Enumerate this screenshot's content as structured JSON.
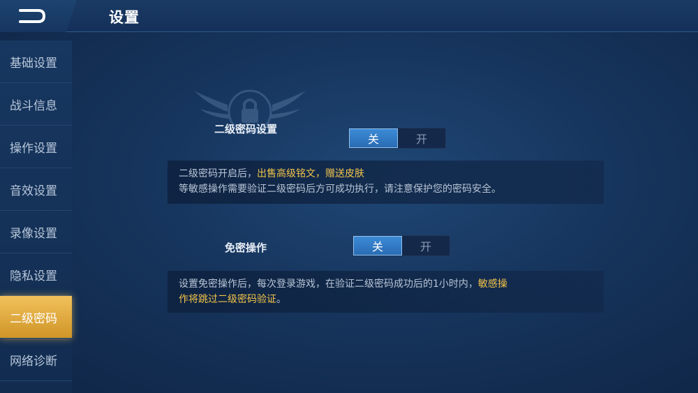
{
  "header": {
    "title": "设置"
  },
  "sidebar": {
    "items": [
      {
        "label": "基础设置"
      },
      {
        "label": "战斗信息"
      },
      {
        "label": "操作设置"
      },
      {
        "label": "音效设置"
      },
      {
        "label": "录像设置"
      },
      {
        "label": "隐私设置"
      },
      {
        "label": "二级密码",
        "active": true
      },
      {
        "label": "网络诊断"
      }
    ]
  },
  "password_setting": {
    "label": "二级密码设置",
    "off_label": "关",
    "on_label": "开",
    "selected": "关",
    "desc_part1": "二级密码开启后，",
    "desc_hl1": "出售高级铭文",
    "desc_sep": "，",
    "desc_hl2": "赠送皮肤",
    "desc_line2": "等敏感操作需要验证二级密码后方可成功执行，请注意保护您的密码安全。"
  },
  "free_op": {
    "label": "免密操作",
    "off_label": "关",
    "on_label": "开",
    "selected": "关",
    "desc_part1": "设置免密操作后，每次登录游戏，在验证二级密码成功后的1小时内，",
    "desc_hl1": "敏感操",
    "desc_hl2": "作将跳过二级密码验证",
    "desc_end": "。"
  },
  "colors": {
    "accent_gold": "#f3c44a",
    "toggle_blue": "#2a6cb4",
    "active_tab": "#e0a83c"
  },
  "icons": {
    "back": "back-arrow-icon",
    "emblem": "lock-emblem-icon"
  }
}
